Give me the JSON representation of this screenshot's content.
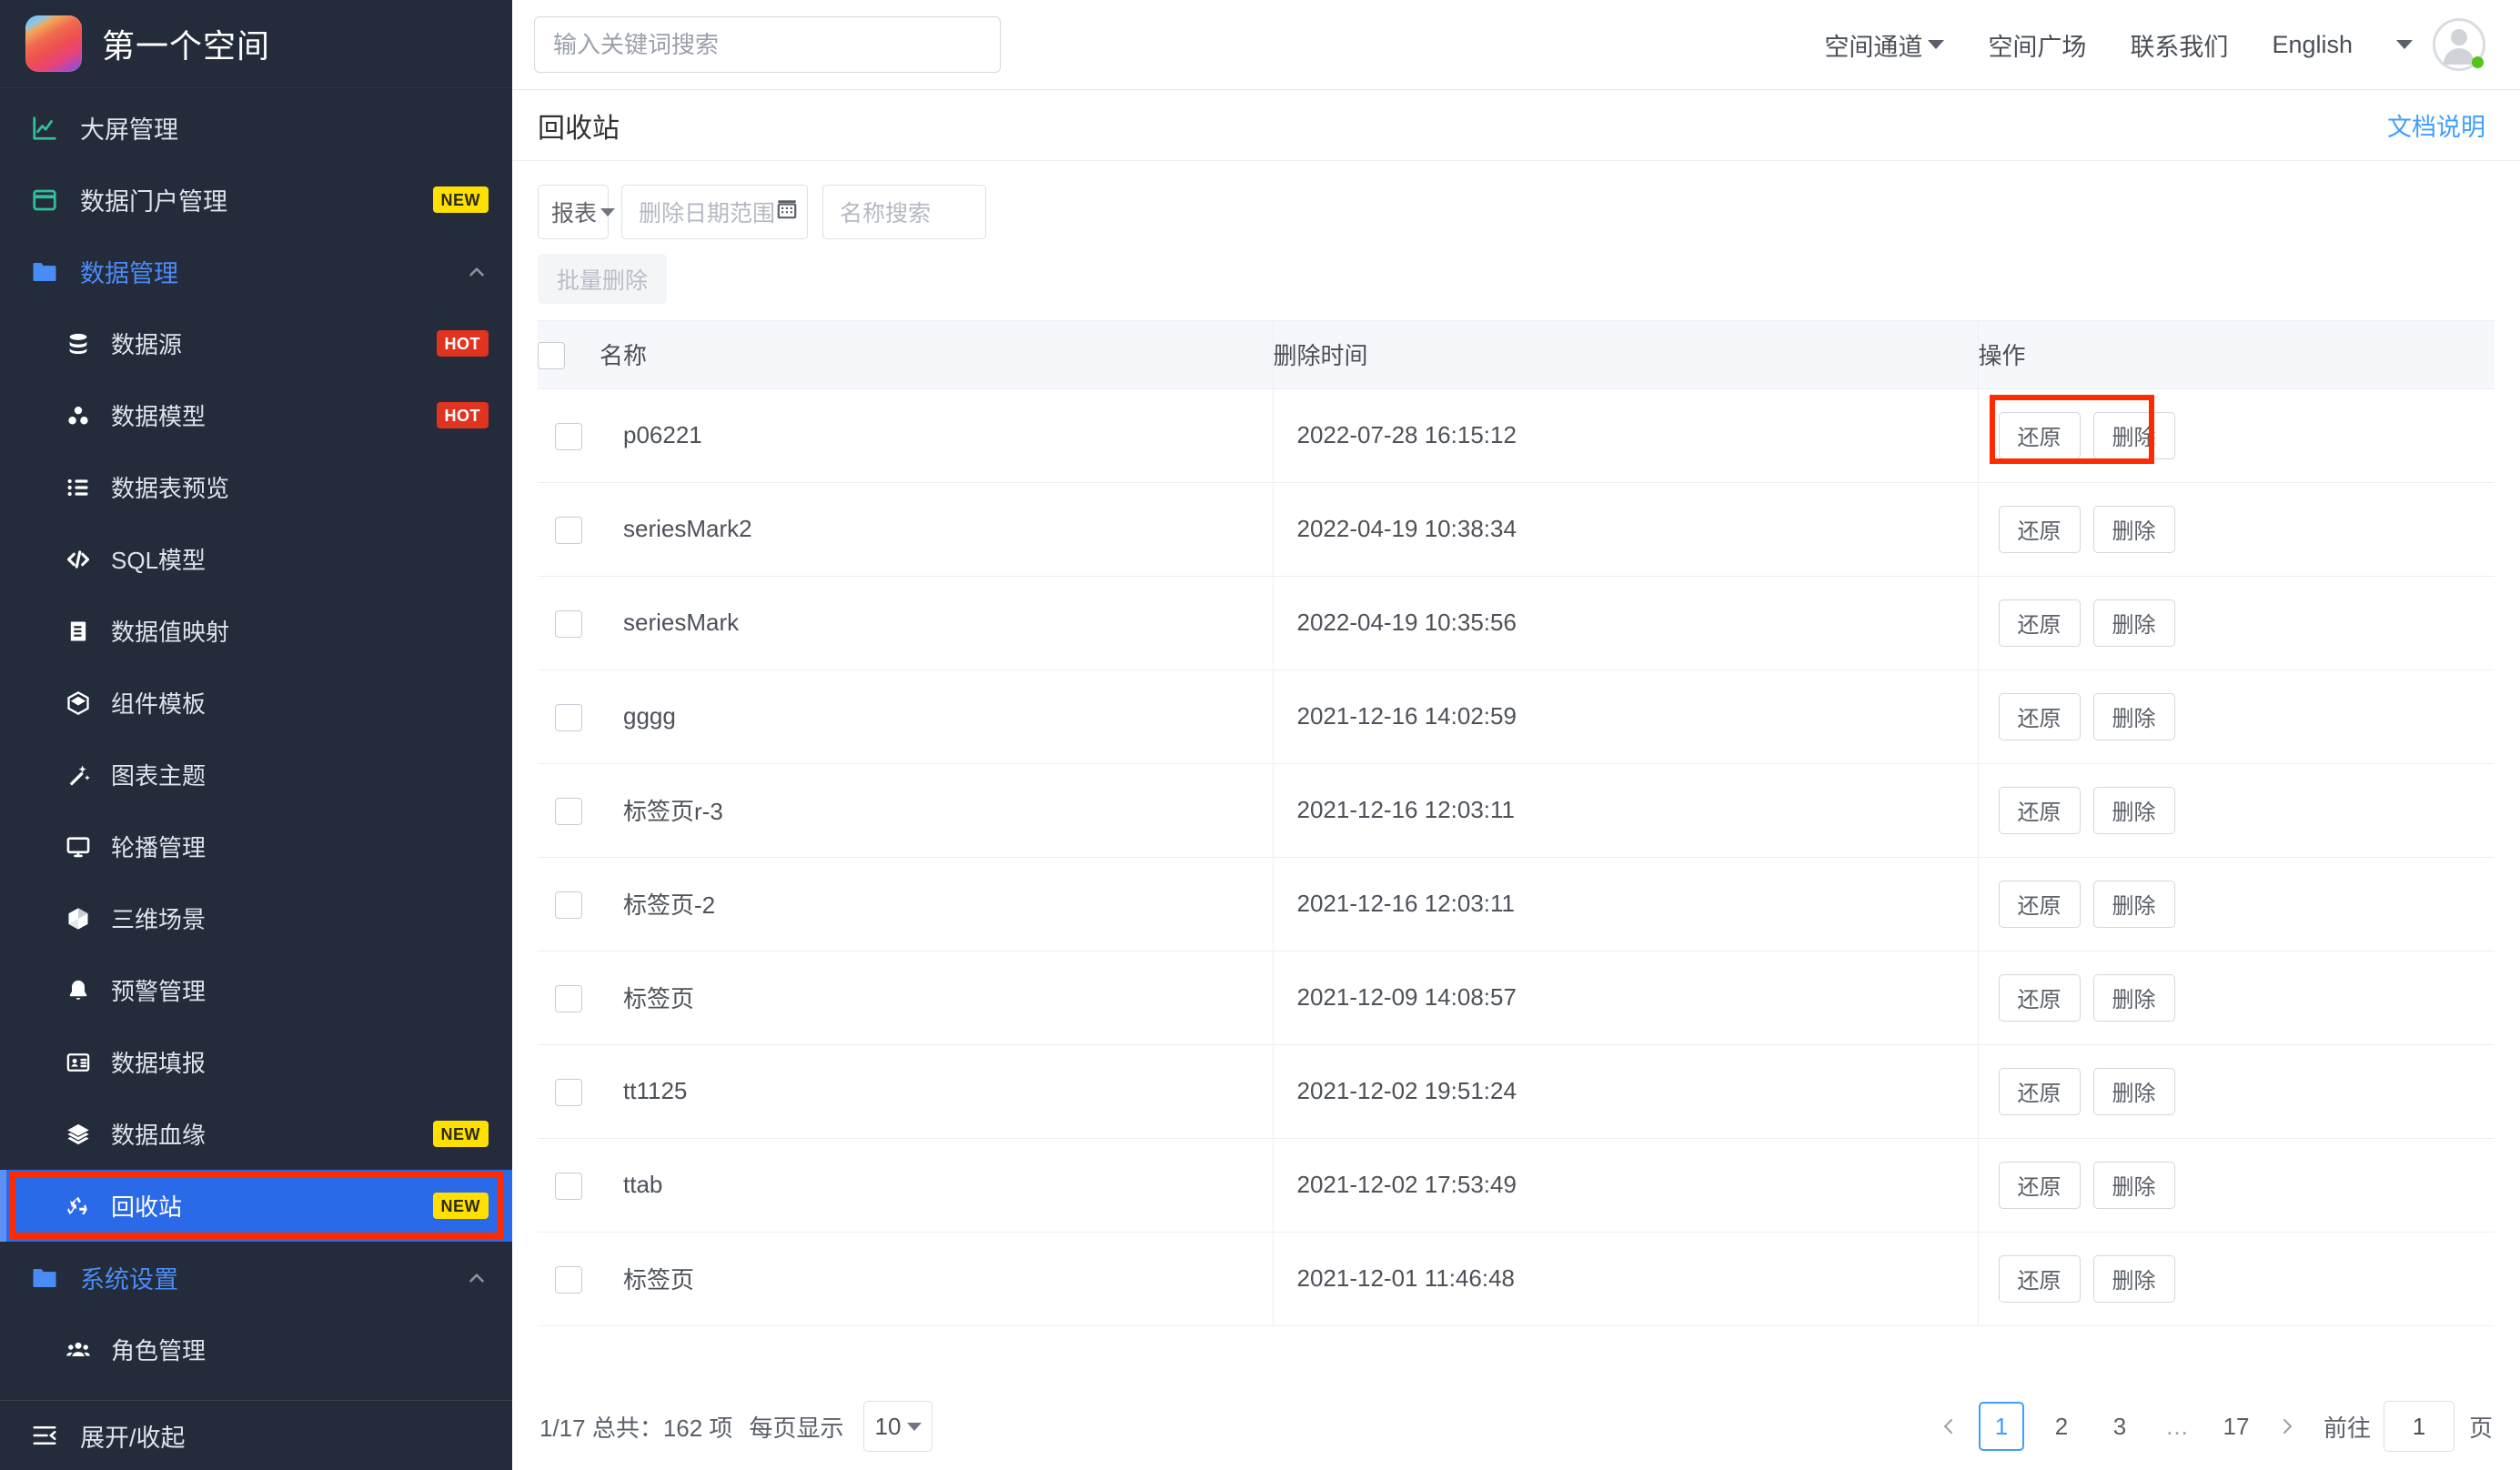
{
  "sidebar": {
    "brand": {
      "title": "第一个空间",
      "logo_icon": "gradient-wallpaper-logo"
    },
    "items": [
      {
        "label": "大屏管理",
        "icon": "chart-line-icon",
        "badge": "",
        "type": "item"
      },
      {
        "label": "数据门户管理",
        "icon": "portal-window-icon",
        "badge": "NEW",
        "badge_kind": "new",
        "type": "item"
      },
      {
        "label": "数据管理",
        "icon": "folder-icon",
        "badge": "",
        "type": "group",
        "expanded": true
      },
      {
        "label": "数据源",
        "icon": "database-icon",
        "badge": "HOT",
        "badge_kind": "hot",
        "type": "sub"
      },
      {
        "label": "数据模型",
        "icon": "model-cubes-icon",
        "badge": "HOT",
        "badge_kind": "hot",
        "type": "sub"
      },
      {
        "label": "数据表预览",
        "icon": "list-icon",
        "badge": "",
        "type": "sub"
      },
      {
        "label": "SQL模型",
        "icon": "code-icon",
        "badge": "",
        "type": "sub"
      },
      {
        "label": "数据值映射",
        "icon": "book-icon",
        "badge": "",
        "type": "sub"
      },
      {
        "label": "组件模板",
        "icon": "component-cube-icon",
        "badge": "",
        "type": "sub"
      },
      {
        "label": "图表主题",
        "icon": "magic-wand-icon",
        "badge": "",
        "type": "sub"
      },
      {
        "label": "轮播管理",
        "icon": "monitor-icon",
        "badge": "",
        "type": "sub"
      },
      {
        "label": "三维场景",
        "icon": "box-3d-icon",
        "badge": "",
        "type": "sub"
      },
      {
        "label": "预警管理",
        "icon": "bell-icon",
        "badge": "",
        "type": "sub"
      },
      {
        "label": "数据填报",
        "icon": "id-card-icon",
        "badge": "",
        "type": "sub"
      },
      {
        "label": "数据血缘",
        "icon": "layers-icon",
        "badge": "NEW",
        "badge_kind": "new",
        "type": "sub"
      },
      {
        "label": "回收站",
        "icon": "recycle-icon",
        "badge": "NEW",
        "badge_kind": "new",
        "type": "sub",
        "active": true
      },
      {
        "label": "系统设置",
        "icon": "folder-icon",
        "badge": "",
        "type": "group",
        "expanded": true
      },
      {
        "label": "角色管理",
        "icon": "users-icon",
        "badge": "",
        "type": "sub"
      }
    ],
    "collapse": {
      "label": "展开/收起",
      "icon": "collapse-icon"
    },
    "active_outline_color": "#ff2a00",
    "active_bg_color": "#2a6ae8"
  },
  "topbar": {
    "search": {
      "value": "",
      "placeholder": "输入关键词搜索",
      "icon": "search-input"
    },
    "links": [
      {
        "label": "空间通道",
        "has_caret": true
      },
      {
        "label": "空间广场",
        "has_caret": false
      },
      {
        "label": "联系我们",
        "has_caret": false
      },
      {
        "label": "English",
        "has_caret": false
      }
    ],
    "account_caret": "chevron-down-icon",
    "avatar": {
      "icon": "avatar",
      "status": "online",
      "status_color": "#52c41a"
    }
  },
  "pagehead": {
    "title": "回收站",
    "doc_link": "文档说明",
    "doc_link_color": "#409eff"
  },
  "toolbar": {
    "type_select": {
      "value": "报表",
      "icon": "chevron-down-icon"
    },
    "date_range": {
      "placeholder": "删除日期范围",
      "value": "",
      "icon": "calendar-icon"
    },
    "name_search": {
      "placeholder": "名称搜索",
      "value": ""
    },
    "batch_delete": {
      "label": "批量删除",
      "disabled": true
    }
  },
  "table": {
    "columns": [
      "名称",
      "删除时间",
      "操作"
    ],
    "select_all_checked": false,
    "action_labels": {
      "restore": "还原",
      "delete": "删除"
    },
    "rows": [
      {
        "name": "p06221",
        "deleted_at": "2022-07-28 16:15:12",
        "checked": false,
        "highlighted": true
      },
      {
        "name": "seriesMark2",
        "deleted_at": "2022-04-19 10:38:34",
        "checked": false
      },
      {
        "name": "seriesMark",
        "deleted_at": "2022-04-19 10:35:56",
        "checked": false
      },
      {
        "name": "gggg",
        "deleted_at": "2021-12-16 14:02:59",
        "checked": false
      },
      {
        "name": "标签页r-3",
        "deleted_at": "2021-12-16 12:03:11",
        "checked": false
      },
      {
        "name": "标签页-2",
        "deleted_at": "2021-12-16 12:03:11",
        "checked": false
      },
      {
        "name": "标签页",
        "deleted_at": "2021-12-09 14:08:57",
        "checked": false
      },
      {
        "name": "tt1125",
        "deleted_at": "2021-12-02 19:51:24",
        "checked": false
      },
      {
        "name": "ttab",
        "deleted_at": "2021-12-02 17:53:49",
        "checked": false
      },
      {
        "name": "标签页",
        "deleted_at": "2021-12-01 11:46:48",
        "checked": false
      }
    ]
  },
  "pagination": {
    "summary": "1/17 总共：162 项",
    "per_page_label": "每页显示",
    "per_page_value": "10",
    "prev_icon": "chevron-left-icon",
    "next_icon": "chevron-right-icon",
    "pages": [
      "1",
      "2",
      "3",
      "…",
      "17"
    ],
    "current_page": "1",
    "goto_label": "前往",
    "goto_value": "1",
    "goto_unit": "页"
  }
}
